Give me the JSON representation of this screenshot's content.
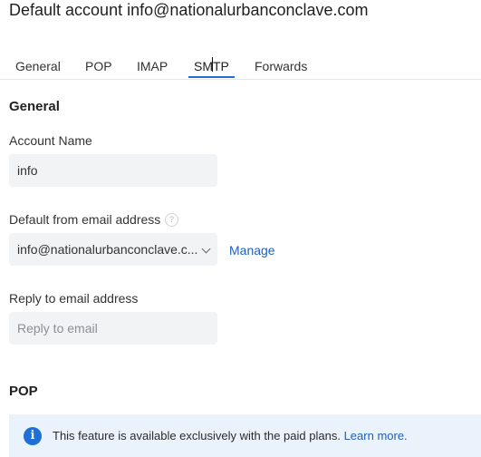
{
  "page": {
    "title": "Default account info@nationalurbanconclave.com"
  },
  "tabs": [
    {
      "label": "General"
    },
    {
      "label": "POP"
    },
    {
      "label": "IMAP"
    },
    {
      "label": "SMTP",
      "active": true
    },
    {
      "label": "Forwards"
    }
  ],
  "general_section": {
    "heading": "General",
    "account_name_label": "Account Name",
    "account_name_value": "info",
    "default_from_label": "Default from email address",
    "default_from_help": "?",
    "default_from_value": "info@nationalurbanconclave.c...",
    "manage_label": "Manage",
    "reply_to_label": "Reply to email address",
    "reply_to_placeholder": "Reply to email"
  },
  "pop_section": {
    "heading": "POP",
    "banner_icon": "info-icon",
    "banner_text": "This feature is available exclusively with the paid plans.",
    "banner_link": "Learn more."
  },
  "colors": {
    "accent": "#1f6fd6",
    "link": "#1f5fbf",
    "field_bg": "#f2f3f4",
    "banner_bg": "#eaf3fb"
  }
}
